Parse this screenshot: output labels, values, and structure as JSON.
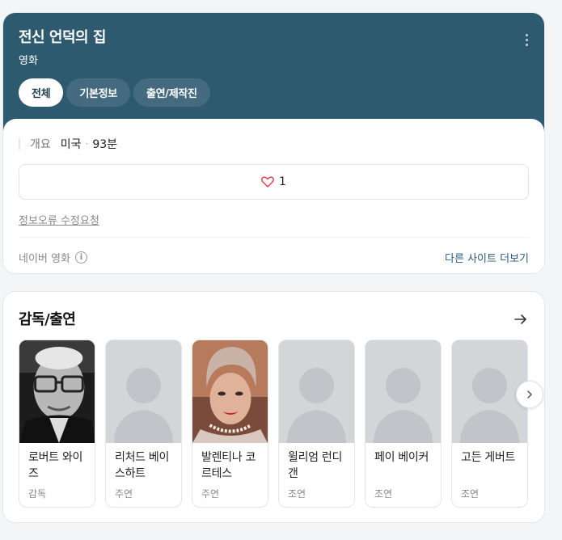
{
  "header": {
    "title": "전신 언덕의 집",
    "subtitle": "영화",
    "tabs": [
      {
        "label": "전체",
        "active": true
      },
      {
        "label": "기본정보",
        "active": false
      },
      {
        "label": "출연/제작진",
        "active": false
      }
    ],
    "more_icon": "more-vertical-icon",
    "background_color": "#2e5a70"
  },
  "summary": {
    "label": "개요",
    "country": "미국",
    "separator": "·",
    "runtime": "93분",
    "like_count": "1",
    "like_icon": "heart-icon",
    "report_link": "정보오류 수정요청",
    "source": "네이버 영화",
    "info_icon": "info-icon",
    "other_sites": "다른 사이트 더보기"
  },
  "cast_section": {
    "title": "감독/출연",
    "arrow_icon": "arrow-right-icon",
    "next_icon": "chevron-right-icon",
    "people": [
      {
        "name": "로버트 와이즈",
        "role": "감독",
        "photo": "elderly-man-glasses-photo"
      },
      {
        "name": "리처드 베이스하트",
        "role": "주연",
        "photo": "placeholder-silhouette"
      },
      {
        "name": "발렌티나 코르테스",
        "role": "주연",
        "photo": "woman-headscarf-photo"
      },
      {
        "name": "윌리엄 런디갠",
        "role": "조연",
        "photo": "placeholder-silhouette"
      },
      {
        "name": "페이 베이커",
        "role": "조연",
        "photo": "placeholder-silhouette"
      },
      {
        "name": "고든 게버트",
        "role": "조연",
        "photo": "placeholder-silhouette"
      }
    ]
  }
}
